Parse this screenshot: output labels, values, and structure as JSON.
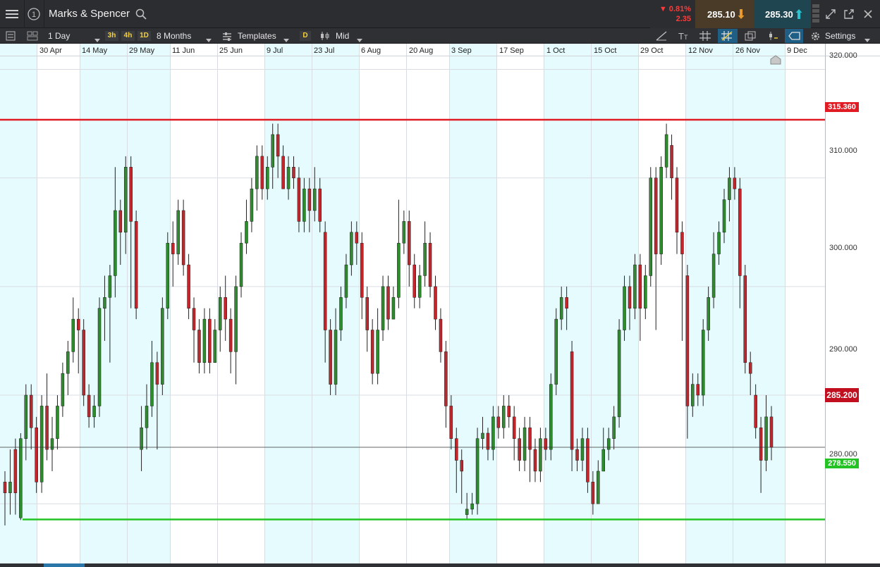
{
  "header": {
    "title": "Marks & Spencer",
    "change_pct": "▼ 0.81%",
    "change_abs": "2.35",
    "sell_price": "285.10",
    "buy_price": "285.30"
  },
  "toolbar": {
    "interval": "1 Day",
    "quick_3h": "3h",
    "quick_4h": "4h",
    "quick_1d": "1D",
    "range": "8 Months",
    "templates": "Templates",
    "d_badge": "D",
    "price_type": "Mid",
    "settings": "Settings"
  },
  "colors": {
    "up": "#2e8b2e",
    "down": "#c0262c",
    "resistance": "#e01b24",
    "support": "#22c322",
    "shade": "#e6fbfd",
    "current": "#c10f1f"
  },
  "chart_data": {
    "type": "candlestick",
    "x_tick_labels": [
      "30 Apr",
      "14 May",
      "29 May",
      "11 Jun",
      "25 Jun",
      "9 Jul",
      "23 Jul",
      "6 Aug",
      "20 Aug",
      "3 Sep",
      "17 Sep",
      "1 Oct",
      "15 Oct",
      "29 Oct",
      "12 Nov",
      "26 Nov",
      "9 Dec"
    ],
    "y_ticks": [
      280,
      290,
      300,
      310,
      320
    ],
    "y_tick_labels": [
      "280.000",
      "290.000",
      "300.000",
      "310.000",
      "320.000"
    ],
    "ylim": [
      274.5,
      321.2
    ],
    "resistance": {
      "value": 315.36,
      "label": "315.360"
    },
    "support": {
      "value": 278.55,
      "label": "278.550"
    },
    "current": {
      "value": 285.2,
      "label": "285.200"
    },
    "candles": [
      [
        282.0,
        281.0,
        283.0,
        278.0
      ],
      [
        281.0,
        282.0,
        285.0,
        279.0
      ],
      [
        285.0,
        281.0,
        286.0,
        279.0
      ],
      [
        278.7,
        286.0,
        286.5,
        278.5
      ],
      [
        286.0,
        290.0,
        291.0,
        284.0
      ],
      [
        290.0,
        287.0,
        291.0,
        285.0
      ],
      [
        287.0,
        282.0,
        288.0,
        281.0
      ],
      [
        282.0,
        289.0,
        290.0,
        281.0
      ],
      [
        289.0,
        285.0,
        292.0,
        284.0
      ],
      [
        285.0,
        286.0,
        288.0,
        283.0
      ],
      [
        286.0,
        289.0,
        290.0,
        285.0
      ],
      [
        289.0,
        292.0,
        293.0,
        288.0
      ],
      [
        292.0,
        294.0,
        295.0,
        290.0
      ],
      [
        294.0,
        297.0,
        299.0,
        293.0
      ],
      [
        297.0,
        296.0,
        298.0,
        292.0
      ],
      [
        296.0,
        290.0,
        297.0,
        289.0
      ],
      [
        290.0,
        288.0,
        291.0,
        287.0
      ],
      [
        288.0,
        289.0,
        290.0,
        287.0
      ],
      [
        289.0,
        298.0,
        299.0,
        288.0
      ],
      [
        298.0,
        299.0,
        301.0,
        295.0
      ],
      [
        299.0,
        301.0,
        302.0,
        293.0
      ],
      [
        301.0,
        307.0,
        311.0,
        299.0
      ],
      [
        307.0,
        305.0,
        308.0,
        302.0
      ],
      [
        305.0,
        311.0,
        312.0,
        303.0
      ],
      [
        311.0,
        306.0,
        312.0,
        298.0
      ],
      [
        306.0,
        298.0,
        307.0,
        297.0
      ],
      [
        285.0,
        287.0,
        289.0,
        283.0
      ],
      [
        287.0,
        289.0,
        291.0,
        285.0
      ],
      [
        289.0,
        293.0,
        295.0,
        288.0
      ],
      [
        293.0,
        291.0,
        294.0,
        285.0
      ],
      [
        291.0,
        298.0,
        299.0,
        290.0
      ],
      [
        298.0,
        304.0,
        305.0,
        297.0
      ],
      [
        304.0,
        303.0,
        306.0,
        300.0
      ],
      [
        303.0,
        307.0,
        308.0,
        302.0
      ],
      [
        307.0,
        302.0,
        308.0,
        301.0
      ],
      [
        302.0,
        298.0,
        303.0,
        297.0
      ],
      [
        298.0,
        296.0,
        299.0,
        293.0
      ],
      [
        296.0,
        293.0,
        297.0,
        292.0
      ],
      [
        293.0,
        297.0,
        298.0,
        292.0
      ],
      [
        297.0,
        293.0,
        298.0,
        292.0
      ],
      [
        293.0,
        296.0,
        297.0,
        293.0
      ],
      [
        296.0,
        299.0,
        300.0,
        294.0
      ],
      [
        299.0,
        297.0,
        301.0,
        295.0
      ],
      [
        297.0,
        294.0,
        298.0,
        292.0
      ],
      [
        294.0,
        300.0,
        301.0,
        291.0
      ],
      [
        300.0,
        304.0,
        305.0,
        299.0
      ],
      [
        304.0,
        306.0,
        308.0,
        303.0
      ],
      [
        306.0,
        309.0,
        310.0,
        305.0
      ],
      [
        309.0,
        312.0,
        313.0,
        307.0
      ],
      [
        312.0,
        309.0,
        313.0,
        308.0
      ],
      [
        309.0,
        311.0,
        312.0,
        308.0
      ],
      [
        311.0,
        314.0,
        315.0,
        309.0
      ],
      [
        314.0,
        312.0,
        315.0,
        310.0
      ],
      [
        312.0,
        309.0,
        313.0,
        309.0
      ],
      [
        309.0,
        311.0,
        312.0,
        308.0
      ],
      [
        311.0,
        310.0,
        312.0,
        309.0
      ],
      [
        310.0,
        306.0,
        311.0,
        305.0
      ],
      [
        306.0,
        309.0,
        310.0,
        305.0
      ],
      [
        309.0,
        307.0,
        310.0,
        305.0
      ],
      [
        307.0,
        309.0,
        311.0,
        306.0
      ],
      [
        309.0,
        306.0,
        310.0,
        305.0
      ],
      [
        305.0,
        296.0,
        306.0,
        293.0
      ],
      [
        296.0,
        291.0,
        297.0,
        290.0
      ],
      [
        291.0,
        296.0,
        298.0,
        290.0
      ],
      [
        296.0,
        299.0,
        300.0,
        295.0
      ],
      [
        299.0,
        302.0,
        303.0,
        298.0
      ],
      [
        302.0,
        305.0,
        306.0,
        301.0
      ],
      [
        305.0,
        304.0,
        306.0,
        302.0
      ],
      [
        304.0,
        299.0,
        305.0,
        297.0
      ],
      [
        299.0,
        296.0,
        300.0,
        294.0
      ],
      [
        296.0,
        292.0,
        297.0,
        291.0
      ],
      [
        292.0,
        296.0,
        298.0,
        291.0
      ],
      [
        296.0,
        300.0,
        301.0,
        295.0
      ],
      [
        300.0,
        297.0,
        301.0,
        296.0
      ],
      [
        297.0,
        299.0,
        300.0,
        297.0
      ],
      [
        299.0,
        304.0,
        308.0,
        298.0
      ],
      [
        304.0,
        306.0,
        307.0,
        303.0
      ],
      [
        306.0,
        302.0,
        307.0,
        300.0
      ],
      [
        302.0,
        299.0,
        303.0,
        298.0
      ],
      [
        299.0,
        301.0,
        302.0,
        298.0
      ],
      [
        301.0,
        304.0,
        306.0,
        300.0
      ],
      [
        304.0,
        300.0,
        305.0,
        299.0
      ],
      [
        300.0,
        297.0,
        301.0,
        296.0
      ],
      [
        297.0,
        294.0,
        298.0,
        293.0
      ],
      [
        294.0,
        289.0,
        295.0,
        287.0
      ],
      [
        289.0,
        286.0,
        290.0,
        285.0
      ],
      [
        286.0,
        284.0,
        287.0,
        281.0
      ],
      [
        284.0,
        283.0,
        285.0,
        280.0
      ],
      [
        279.0,
        279.5,
        281.0,
        278.5
      ],
      [
        279.5,
        280.0,
        281.0,
        279.0
      ],
      [
        280.0,
        286.0,
        287.0,
        279.0
      ],
      [
        286.0,
        286.5,
        288.0,
        285.0
      ],
      [
        286.5,
        285.0,
        287.0,
        284.0
      ],
      [
        285.0,
        288.0,
        289.0,
        284.0
      ],
      [
        288.0,
        287.0,
        289.0,
        286.0
      ],
      [
        287.0,
        289.0,
        290.0,
        286.0
      ],
      [
        289.0,
        288.0,
        290.0,
        287.0
      ],
      [
        288.0,
        286.0,
        289.0,
        284.0
      ],
      [
        286.0,
        284.0,
        287.0,
        283.0
      ],
      [
        284.0,
        287.0,
        288.0,
        283.0
      ],
      [
        287.0,
        285.0,
        288.0,
        282.0
      ],
      [
        285.0,
        283.0,
        286.0,
        282.0
      ],
      [
        283.0,
        286.0,
        287.0,
        282.0
      ],
      [
        286.0,
        285.0,
        287.0,
        284.0
      ],
      [
        285.0,
        291.0,
        292.0,
        284.0
      ],
      [
        291.0,
        297.0,
        298.0,
        290.0
      ],
      [
        297.0,
        299.0,
        300.0,
        296.0
      ],
      [
        299.0,
        298.0,
        300.0,
        296.0
      ],
      [
        294.0,
        285.0,
        295.0,
        283.0
      ],
      [
        285.0,
        284.0,
        286.0,
        283.0
      ],
      [
        284.0,
        286.0,
        287.0,
        283.0
      ],
      [
        286.0,
        282.0,
        287.0,
        281.0
      ],
      [
        282.0,
        280.0,
        283.0,
        279.0
      ],
      [
        280.0,
        283.0,
        284.0,
        282.0
      ],
      [
        283.0,
        285.0,
        287.0,
        284.0
      ],
      [
        285.0,
        286.0,
        287.0,
        284.0
      ],
      [
        286.0,
        288.0,
        289.0,
        285.0
      ],
      [
        288.0,
        296.0,
        297.0,
        287.0
      ],
      [
        296.0,
        300.0,
        301.0,
        295.0
      ],
      [
        300.0,
        298.0,
        301.0,
        296.0
      ],
      [
        298.0,
        302.0,
        303.0,
        297.0
      ],
      [
        302.0,
        298.0,
        303.0,
        295.0
      ],
      [
        298.0,
        301.0,
        302.0,
        297.0
      ],
      [
        301.0,
        310.0,
        311.0,
        300.0
      ],
      [
        310.0,
        303.0,
        311.0,
        296.0
      ],
      [
        303.0,
        311.0,
        312.0,
        302.0
      ],
      [
        311.0,
        314.0,
        315.0,
        310.0
      ],
      [
        313.0,
        310.0,
        314.0,
        308.0
      ],
      [
        310.0,
        305.0,
        311.0,
        303.0
      ],
      [
        305.0,
        303.0,
        306.0,
        295.0
      ],
      [
        301.0,
        289.0,
        302.0,
        286.0
      ],
      [
        289.0,
        291.0,
        292.0,
        288.0
      ],
      [
        291.0,
        290.0,
        292.0,
        289.0
      ],
      [
        290.0,
        296.0,
        297.0,
        289.0
      ],
      [
        296.0,
        299.0,
        300.0,
        295.0
      ],
      [
        299.0,
        303.0,
        305.0,
        298.0
      ],
      [
        303.0,
        305.0,
        306.0,
        302.0
      ],
      [
        305.0,
        308.0,
        309.0,
        304.0
      ],
      [
        308.0,
        310.0,
        311.0,
        306.0
      ],
      [
        310.0,
        309.0,
        311.0,
        308.0
      ],
      [
        309.0,
        301.0,
        310.0,
        298.0
      ],
      [
        301.0,
        293.0,
        302.0,
        292.0
      ],
      [
        293.0,
        292.0,
        294.0,
        290.0
      ],
      [
        290.0,
        287.0,
        291.0,
        286.0
      ],
      [
        287.0,
        284.0,
        288.0,
        281.0
      ],
      [
        284.0,
        288.0,
        290.0,
        283.0
      ],
      [
        288.0,
        285.2,
        289.0,
        284.0
      ]
    ]
  }
}
